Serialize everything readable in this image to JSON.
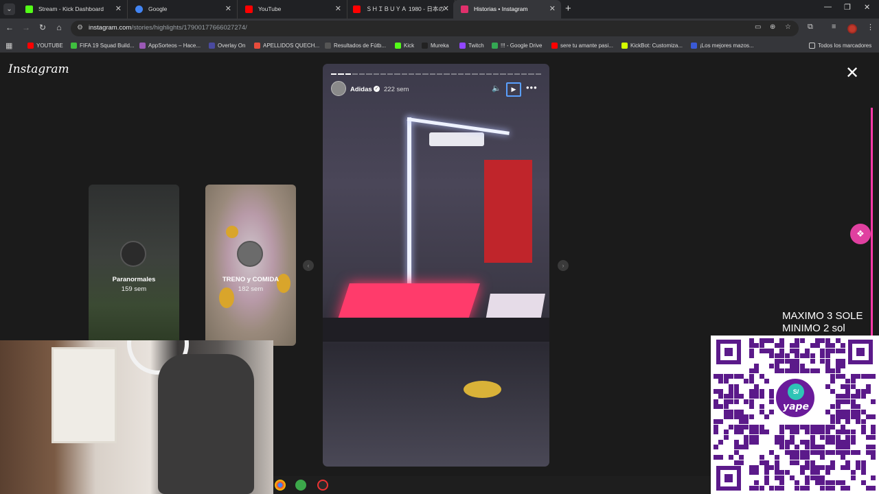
{
  "tabs": [
    {
      "label": "Stream - Kick Dashboard",
      "color": "#53fc18"
    },
    {
      "label": "Google",
      "color": "#4285f4"
    },
    {
      "label": "YouTube",
      "color": "#ff0000"
    },
    {
      "label": "ＳＨＩＢＵＹＡ 1980 - 日本の",
      "color": "#ff0000"
    },
    {
      "label": "Historias • Instagram",
      "color": "#e1306c",
      "active": true
    }
  ],
  "address": {
    "host": "instagram.com",
    "path": "/stories/highlights/17900177666027274/"
  },
  "bookmarks": [
    {
      "label": "YOUTUBE",
      "color": "#ff0000"
    },
    {
      "label": "FIFA 19 Squad Build...",
      "color": "#3fbf3f"
    },
    {
      "label": "AppSorteos – Hace...",
      "color": "#9b59b6"
    },
    {
      "label": "Overlay On",
      "color": "#4a4aa0"
    },
    {
      "label": "APELLIDOS QUECH...",
      "color": "#e74c3c"
    },
    {
      "label": "Resultados de Fútb...",
      "color": "#555555"
    },
    {
      "label": "Kick",
      "color": "#53fc18"
    },
    {
      "label": "Mureka",
      "color": "#222222"
    },
    {
      "label": "Twitch",
      "color": "#9146ff"
    },
    {
      "label": "!!! - Google Drive",
      "color": "#34a853"
    },
    {
      "label": "sere tu amante pasi...",
      "color": "#ff0000"
    },
    {
      "label": "KickBot: Customiza...",
      "color": "#d4ff00"
    },
    {
      "label": "¡Los mejores mazos...",
      "color": "#3a5ad6"
    }
  ],
  "bookmarks_all": "Todos los marcadores",
  "instagram": {
    "logo": "Instagram",
    "highlights": [
      {
        "name": "Paranormales",
        "age": "159 sem"
      },
      {
        "name": "TRENO y COMIDA",
        "age": "182 sem"
      }
    ],
    "story": {
      "user": "Adidas",
      "age": "222 sem",
      "segments_total": 30,
      "segments_done": 3
    }
  },
  "overlay": {
    "donation_line1": "MAXIMO 3 SOLE",
    "donation_line2": "MINIMO 2 sol",
    "qr_badge": "S/",
    "qr_brand": "yape"
  },
  "colors": {
    "accent_pink": "#ff3aa8",
    "yape_purple": "#5b1a8a"
  }
}
